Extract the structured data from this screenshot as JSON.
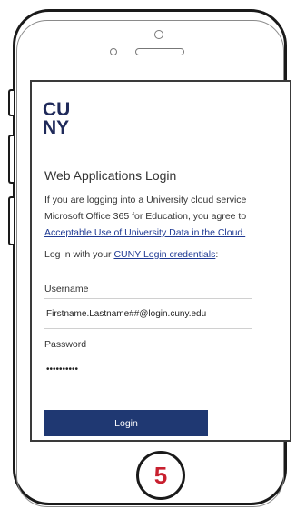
{
  "logo": {
    "line1": "CU",
    "line2": "NY",
    "color": "#1f2a5a"
  },
  "page": {
    "title": "Web Applications Login",
    "intro_line1": "If you are logging into a University cloud service",
    "intro_line2": "Microsoft Office 365 for Education, you agree to",
    "intro_link": "Acceptable Use of University Data in the Cloud.",
    "credentials_prefix": "Log in with your ",
    "credentials_link": "CUNY Login credentials",
    "credentials_suffix": ":"
  },
  "form": {
    "username_label": "Username",
    "username_value": "Firstname.Lastname##@login.cuny.edu",
    "password_label": "Password",
    "password_value": "••••••••••",
    "login_button": "Login"
  },
  "step": {
    "number": "5",
    "color": "#c8202f"
  },
  "colors": {
    "link": "#1f3a93",
    "button": "#1f3872"
  }
}
